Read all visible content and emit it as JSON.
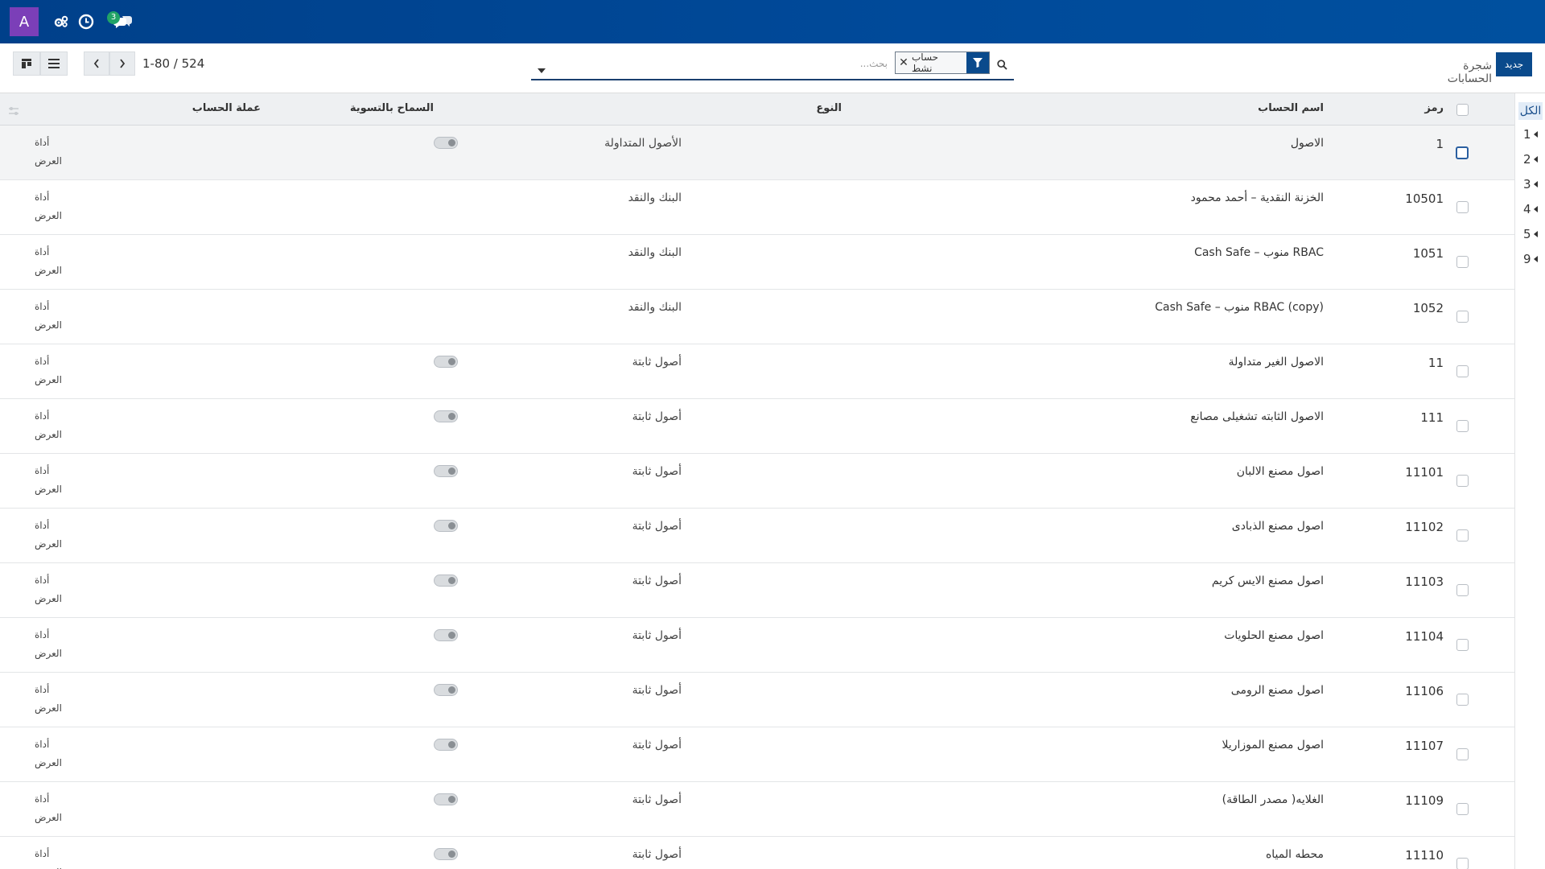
{
  "topbar": {
    "avatar_letter": "A",
    "chat_badge": "3",
    "colors": {
      "bar": "#00408a",
      "avatar": "#7b3fb8",
      "badge": "#21a366"
    }
  },
  "control": {
    "pager": "1-80 / 524",
    "search_placeholder": "بحث...",
    "facet_label": "حساب نشط",
    "new_button": "جديد",
    "breadcrumb": "شجرة الحسابات"
  },
  "table": {
    "headers": {
      "code": "رمز",
      "name": "اسم الحساب",
      "type": "النوع",
      "reconcile": "السماح بالتسوية",
      "currency": "عملة الحساب"
    },
    "rows": [
      {
        "code": "1",
        "name": "الاصول",
        "type": "الأصول المتداولة",
        "toggle": true,
        "cur1": "أداة",
        "cur2": "العرض"
      },
      {
        "code": "10501",
        "name": "الخزنة النقدية – أحمد محمود",
        "type": "البنك والنقد",
        "toggle": false,
        "cur1": "أداة",
        "cur2": "العرض"
      },
      {
        "code": "1051",
        "name": "Cash Safe – منوب RBAC",
        "type": "البنك والنقد",
        "toggle": false,
        "cur1": "أداة",
        "cur2": "العرض"
      },
      {
        "code": "1052",
        "name": "Cash Safe – منوب RBAC (copy)",
        "type": "البنك والنقد",
        "toggle": false,
        "cur1": "أداة",
        "cur2": "العرض"
      },
      {
        "code": "11",
        "name": "الاصول الغير متداولة",
        "type": "أصول ثابتة",
        "toggle": true,
        "cur1": "أداة",
        "cur2": "العرض"
      },
      {
        "code": "111",
        "name": "الاصول الثابته تشغيلى مصانع",
        "type": "أصول ثابتة",
        "toggle": true,
        "cur1": "أداة",
        "cur2": "العرض"
      },
      {
        "code": "11101",
        "name": "اصول مصنع الالبان",
        "type": "أصول ثابتة",
        "toggle": true,
        "cur1": "أداة",
        "cur2": "العرض"
      },
      {
        "code": "11102",
        "name": "اصول مصنع الذبادى",
        "type": "أصول ثابتة",
        "toggle": true,
        "cur1": "أداة",
        "cur2": "العرض"
      },
      {
        "code": "11103",
        "name": "اصول مصنع الايس كريم",
        "type": "أصول ثابتة",
        "toggle": true,
        "cur1": "أداة",
        "cur2": "العرض"
      },
      {
        "code": "11104",
        "name": "اصول مصنع الحلويات",
        "type": "أصول ثابتة",
        "toggle": true,
        "cur1": "أداة",
        "cur2": "العرض"
      },
      {
        "code": "11106",
        "name": "اصول مصنع الرومى",
        "type": "أصول ثابتة",
        "toggle": true,
        "cur1": "أداة",
        "cur2": "العرض"
      },
      {
        "code": "11107",
        "name": "اصول مصنع الموزاريلا",
        "type": "أصول ثابتة",
        "toggle": true,
        "cur1": "أداة",
        "cur2": "العرض"
      },
      {
        "code": "11109",
        "name": "الغلايه( مصدر الطاقة)",
        "type": "أصول ثابتة",
        "toggle": true,
        "cur1": "أداة",
        "cur2": "العرض"
      },
      {
        "code": "11110",
        "name": "محطه المياه",
        "type": "أصول ثابتة",
        "toggle": true,
        "cur1": "أداة",
        "cur2": "العرض"
      }
    ]
  },
  "levels": {
    "all_label": "الكل",
    "items": [
      "1",
      "2",
      "3",
      "4",
      "5",
      "9"
    ]
  }
}
